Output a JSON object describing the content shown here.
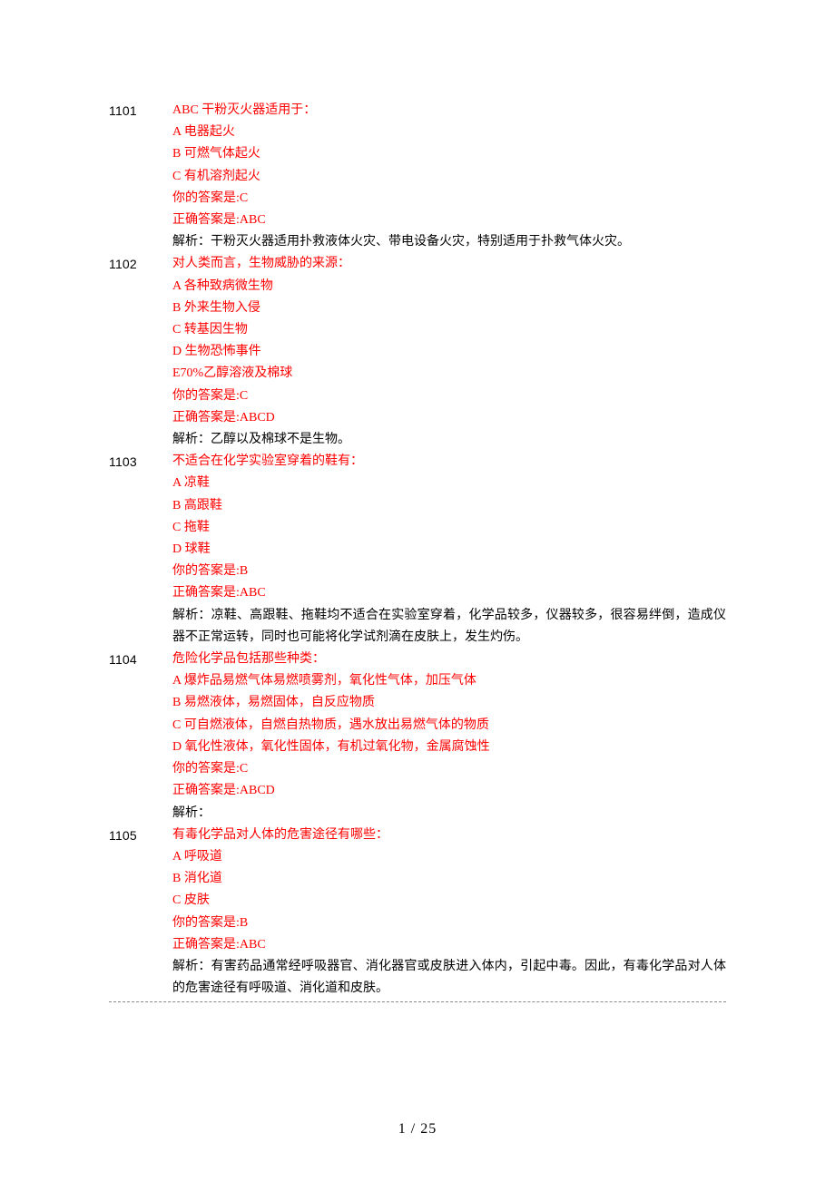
{
  "footer": "1 / 25",
  "questions": [
    {
      "number": "1101",
      "stem": "ABC 干粉灭火器适用于：",
      "options": [
        "A 电器起火",
        "B 可燃气体起火",
        "C 有机溶剂起火"
      ],
      "your_answer": "你的答案是:C",
      "correct_answer": "正确答案是:ABC",
      "analysis": "解析：干粉灭火器适用扑救液体火灾、带电设备火灾，特别适用于扑救气体火灾。"
    },
    {
      "number": "1102",
      "stem": "对人类而言，生物威胁的来源：",
      "options": [
        "A 各种致病微生物",
        "B 外来生物入侵",
        "C 转基因生物",
        "D 生物恐怖事件",
        "E70%乙醇溶液及棉球"
      ],
      "your_answer": "你的答案是:C",
      "correct_answer": "正确答案是:ABCD",
      "analysis": "解析：乙醇以及棉球不是生物。"
    },
    {
      "number": "1103",
      "stem": "不适合在化学实验室穿着的鞋有：",
      "options": [
        "A 凉鞋",
        "B 高跟鞋",
        "C 拖鞋",
        "D 球鞋"
      ],
      "your_answer": "你的答案是:B",
      "correct_answer": "正确答案是:ABC",
      "analysis": "解析：凉鞋、高跟鞋、拖鞋均不适合在实验室穿着，化学品较多，仪器较多，很容易绊倒，造成仪器不正常运转，同时也可能将化学试剂滴在皮肤上，发生灼伤。"
    },
    {
      "number": "1104",
      "stem": "危险化学品包括那些种类：",
      "options": [
        "A 爆炸品易燃气体易燃喷雾剂，氧化性气体，加压气体",
        "B 易燃液体，易燃固体，自反应物质",
        "C 可自燃液体，自燃自热物质，遇水放出易燃气体的物质",
        "D 氧化性液体，氧化性固体，有机过氧化物，金属腐蚀性"
      ],
      "your_answer": "你的答案是:C",
      "correct_answer": "正确答案是:ABCD",
      "analysis": "解析："
    },
    {
      "number": "1105",
      "stem": "有毒化学品对人体的危害途径有哪些：",
      "options": [
        "A 呼吸道",
        "B 消化道",
        "C 皮肤"
      ],
      "your_answer": "你的答案是:B",
      "correct_answer": "正确答案是:ABC",
      "analysis": "解析：有害药品通常经呼吸器官、消化器官或皮肤进入体内，引起中毒。因此，有毒化学品对人体的危害途径有呼吸道、消化道和皮肤。"
    }
  ]
}
